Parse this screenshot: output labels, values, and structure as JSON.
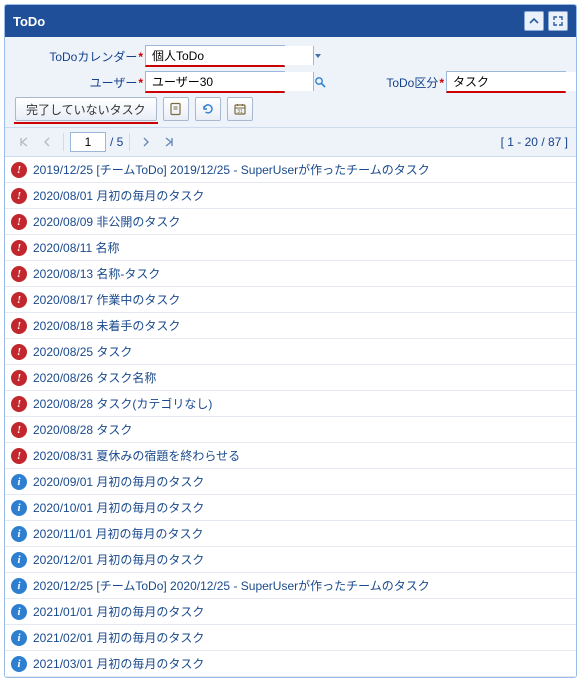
{
  "header": {
    "title": "ToDo"
  },
  "filters": {
    "calendar": {
      "label": "ToDoカレンダー",
      "value": "個人ToDo"
    },
    "user": {
      "label": "ユーザー",
      "value": "ユーザー30"
    },
    "kind": {
      "label": "ToDo区分",
      "value": "タスク"
    }
  },
  "toolbar": {
    "incomplete_label": "完了していないタスク"
  },
  "paging": {
    "page": "1",
    "total_pages": "5",
    "status": "[ 1 - 20 / 87 ]"
  },
  "rows": [
    {
      "status": "alert",
      "text": "2019/12/25 [チームToDo] 2019/12/25 - SuperUserが作ったチームのタスク"
    },
    {
      "status": "alert",
      "text": "2020/08/01 月初の毎月のタスク"
    },
    {
      "status": "alert",
      "text": "2020/08/09 非公開のタスク"
    },
    {
      "status": "alert",
      "text": "2020/08/11 名称"
    },
    {
      "status": "alert",
      "text": "2020/08/13 名称-タスク"
    },
    {
      "status": "alert",
      "text": "2020/08/17 作業中のタスク"
    },
    {
      "status": "alert",
      "text": "2020/08/18 未着手のタスク"
    },
    {
      "status": "alert",
      "text": "2020/08/25 タスク"
    },
    {
      "status": "alert",
      "text": "2020/08/26 タスク名称"
    },
    {
      "status": "alert",
      "text": "2020/08/28 タスク(カテゴリなし)"
    },
    {
      "status": "alert",
      "text": "2020/08/28 タスク"
    },
    {
      "status": "alert",
      "text": "2020/08/31 夏休みの宿題を終わらせる"
    },
    {
      "status": "info",
      "text": "2020/09/01 月初の毎月のタスク"
    },
    {
      "status": "info",
      "text": "2020/10/01 月初の毎月のタスク"
    },
    {
      "status": "info",
      "text": "2020/11/01 月初の毎月のタスク"
    },
    {
      "status": "info",
      "text": "2020/12/01 月初の毎月のタスク"
    },
    {
      "status": "info",
      "text": "2020/12/25 [チームToDo] 2020/12/25 - SuperUserが作ったチームのタスク"
    },
    {
      "status": "info",
      "text": "2021/01/01 月初の毎月のタスク"
    },
    {
      "status": "info",
      "text": "2021/02/01 月初の毎月のタスク"
    },
    {
      "status": "info",
      "text": "2021/03/01 月初の毎月のタスク"
    }
  ]
}
